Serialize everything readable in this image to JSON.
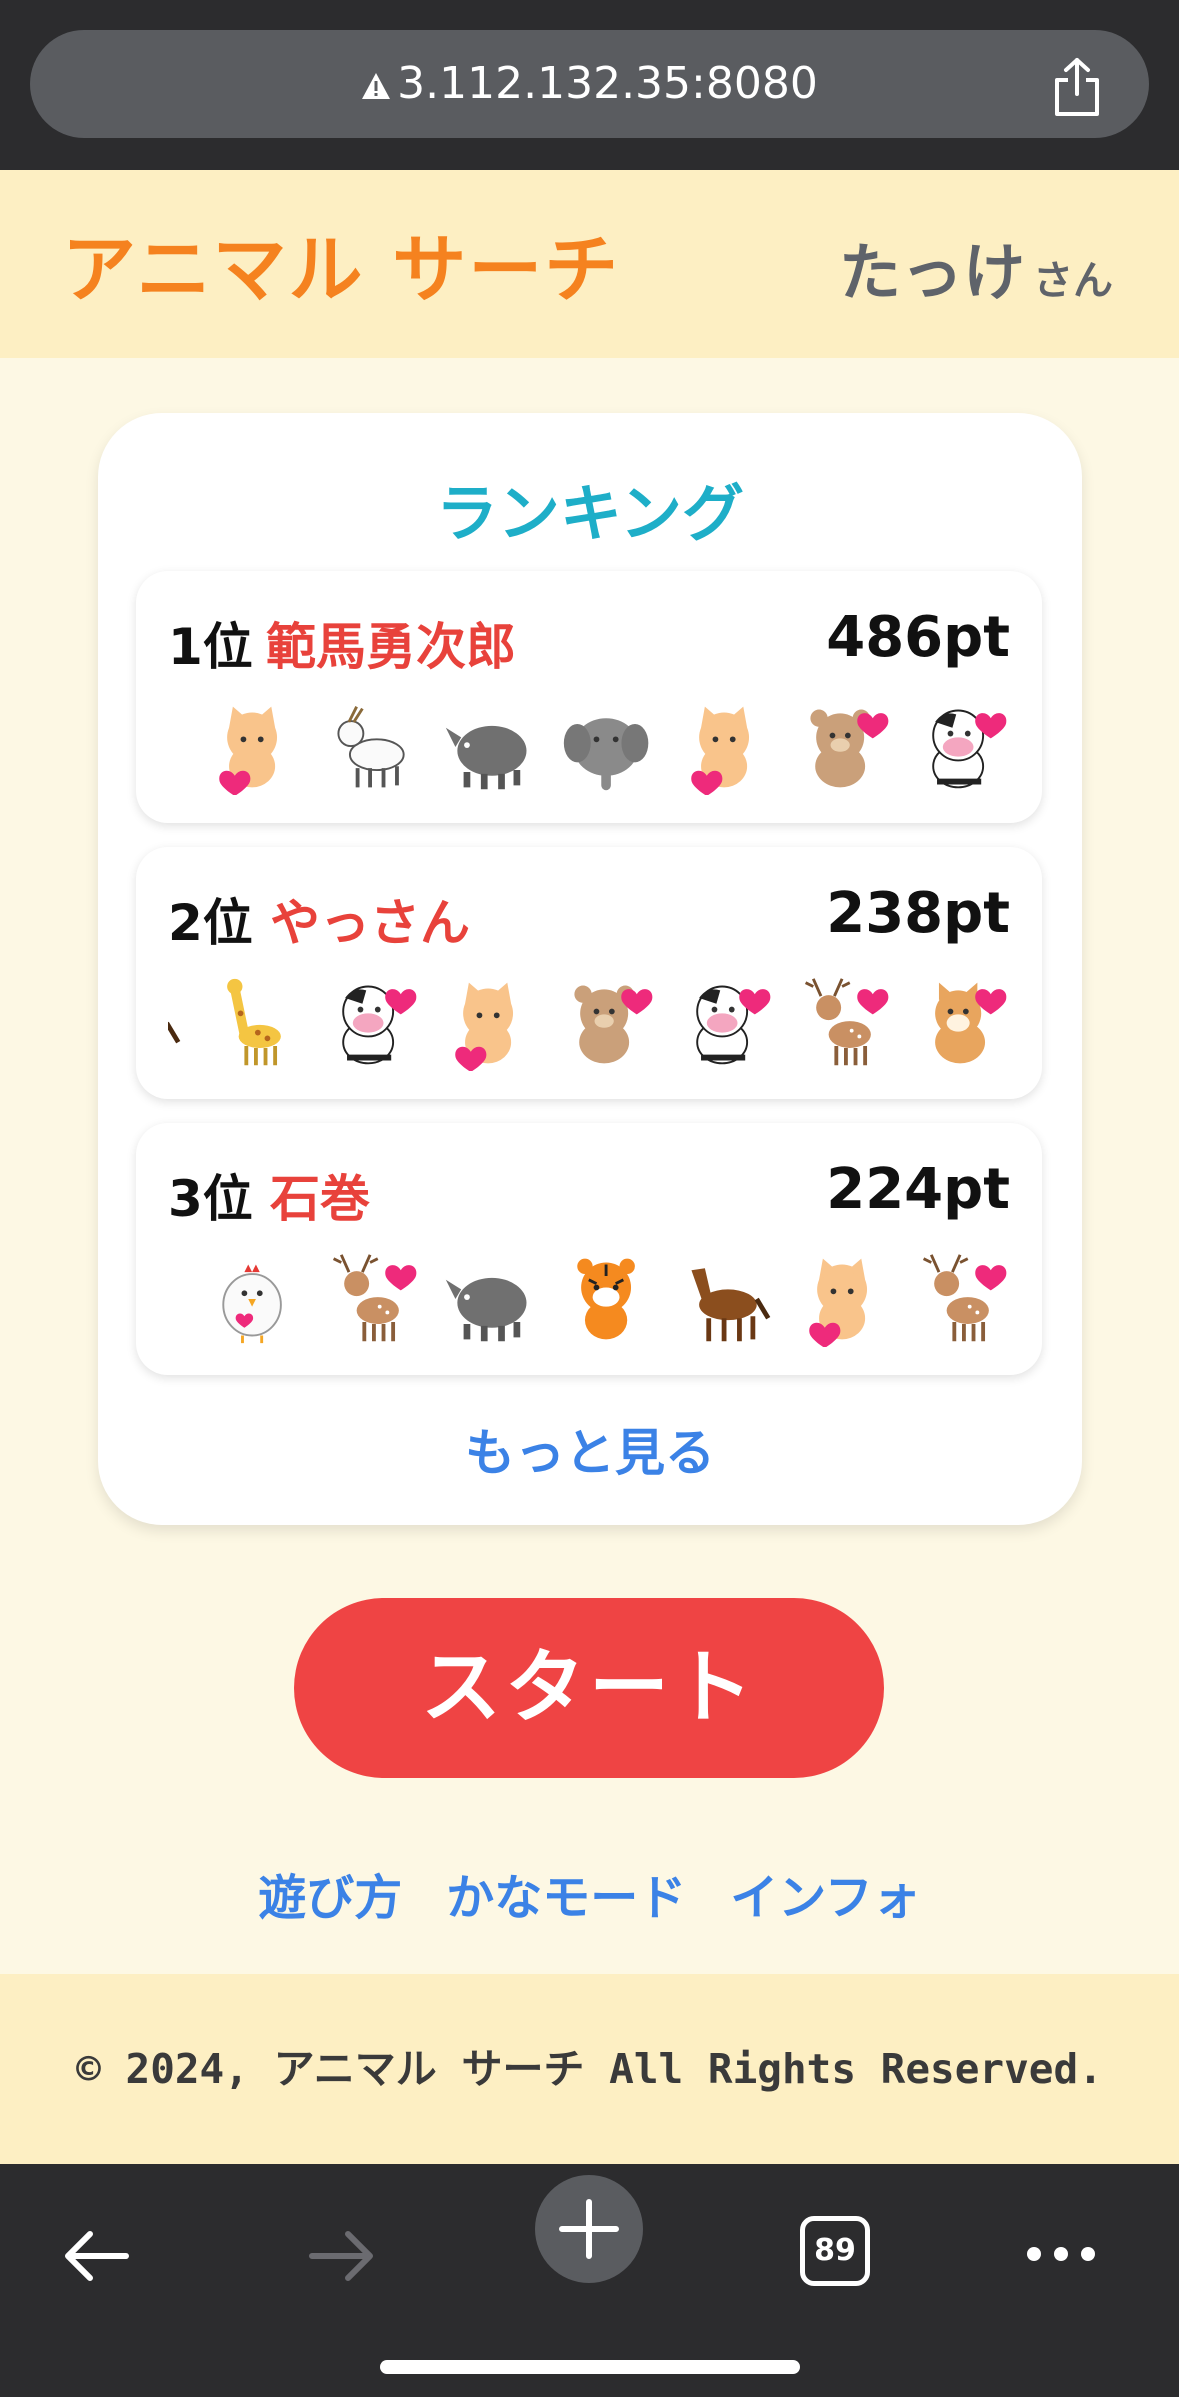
{
  "browser": {
    "url": "3.112.132.35:8080",
    "tab_count": "89"
  },
  "header": {
    "title": "アニマル サーチ",
    "user_name": "たっけ",
    "user_suffix": "さん"
  },
  "ranking": {
    "title": "ランキング",
    "entries": [
      {
        "rank": "1位",
        "name": "範馬勇次郎",
        "score": "486pt",
        "animals": [
          "cat-icon",
          "goat-icon",
          "rhino-icon",
          "elephant-icon",
          "cat-icon",
          "bear-icon",
          "cow-icon"
        ]
      },
      {
        "rank": "2位",
        "name": "やっさん",
        "score": "238pt",
        "animals": [
          "horse-icon",
          "giraffe-icon",
          "cow-icon",
          "cat-icon",
          "bear-icon",
          "cow-icon",
          "deer-icon",
          "shiba-dog-icon"
        ]
      },
      {
        "rank": "3位",
        "name": "石巻",
        "score": "224pt",
        "animals": [
          "chick-icon",
          "deer-icon",
          "rhino-icon",
          "tiger-icon",
          "horse-icon",
          "cat-icon",
          "deer-icon"
        ]
      }
    ],
    "more_label": "もっと見る"
  },
  "start_label": "スタート",
  "links": {
    "how_to_play": "遊び方",
    "kana_mode": "かなモード",
    "info": "インフォ"
  },
  "footer": {
    "copyright": "© 2024, アニマル サーチ All Rights Reserved."
  },
  "colors": {
    "title_orange": "#f5821f",
    "ranking_title": "#1eaec8",
    "player_name_red": "#e8423b",
    "link_blue": "#3b82e6",
    "start_red": "#ef4444",
    "header_bg": "#fdefc3",
    "page_bg": "#fdf8e4"
  }
}
